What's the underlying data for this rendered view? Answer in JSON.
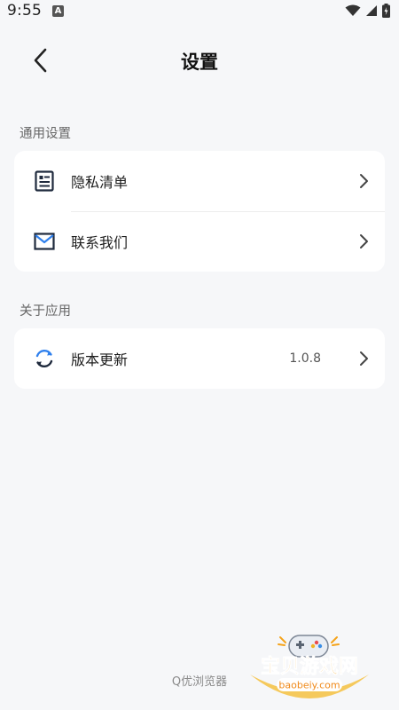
{
  "status_bar": {
    "time": "9:55",
    "notification_glyph": "A"
  },
  "header": {
    "title": "设置"
  },
  "sections": [
    {
      "label": "通用设置",
      "items": [
        {
          "label": "隐私清单",
          "icon": "document-list-icon"
        },
        {
          "label": "联系我们",
          "icon": "mail-icon"
        }
      ]
    },
    {
      "label": "关于应用",
      "items": [
        {
          "label": "版本更新",
          "icon": "refresh-icon",
          "value": "1.0.8"
        }
      ]
    }
  ],
  "footer": {
    "brand": "Q优浏览器"
  },
  "watermark": {
    "text": "宝贝游戏网",
    "url": "baobeiy.com"
  },
  "colors": {
    "background": "#f6f7f9",
    "card": "#ffffff",
    "icon_dark": "#1f2a3d",
    "icon_blue": "#2f80ed",
    "watermark_orange": "#f5a31a"
  }
}
